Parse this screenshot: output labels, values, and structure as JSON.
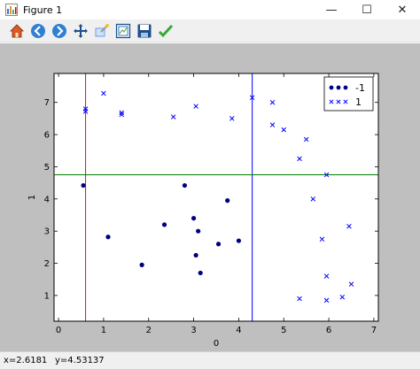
{
  "window": {
    "title": "Figure 1",
    "minimize_glyph": "—",
    "maximize_glyph": "☐",
    "close_glyph": "✕"
  },
  "toolbar": {
    "buttons": [
      "home-icon",
      "back-arrow-icon",
      "forward-arrow-icon",
      "pan-icon",
      "zoom-icon",
      "configure-subplots-icon",
      "save-icon",
      "edit-icon"
    ]
  },
  "status": {
    "x_readout": "x=2.6181",
    "y_readout": "y=4.53137"
  },
  "chart_data": {
    "type": "scatter",
    "xlabel": "0",
    "ylabel": "1",
    "xlim": [
      -0.1,
      7.1
    ],
    "ylim": [
      0.2,
      7.9
    ],
    "xticks": [
      "0",
      "1",
      "2",
      "3",
      "4",
      "5",
      "6",
      "7"
    ],
    "yticks": [
      "1",
      "2",
      "3",
      "4",
      "5",
      "6",
      "7"
    ],
    "vlines": [
      {
        "x": 0.6,
        "color": "#ff0000"
      },
      {
        "x": 4.3,
        "color": "#0000ff"
      }
    ],
    "hlines": [
      {
        "y": 4.75,
        "color": "#008000"
      }
    ],
    "legend_position": "top-right",
    "series": [
      {
        "name": "-1",
        "marker": "dot",
        "color": "#000080",
        "points": [
          [
            0.55,
            4.42
          ],
          [
            1.1,
            2.82
          ],
          [
            1.85,
            1.95
          ],
          [
            2.35,
            3.2
          ],
          [
            2.8,
            4.42
          ],
          [
            3.0,
            3.4
          ],
          [
            3.05,
            2.25
          ],
          [
            3.1,
            3.0
          ],
          [
            3.15,
            1.7
          ],
          [
            3.55,
            2.6
          ],
          [
            3.75,
            3.95
          ],
          [
            4.0,
            2.7
          ]
        ]
      },
      {
        "name": "1",
        "marker": "x",
        "color": "#0000ff",
        "points": [
          [
            0.6,
            6.8
          ],
          [
            0.6,
            6.72
          ],
          [
            1.0,
            7.28
          ],
          [
            1.4,
            6.68
          ],
          [
            1.4,
            6.62
          ],
          [
            2.55,
            6.55
          ],
          [
            3.05,
            6.88
          ],
          [
            3.85,
            6.5
          ],
          [
            4.3,
            7.15
          ],
          [
            4.75,
            7.0
          ],
          [
            4.75,
            6.3
          ],
          [
            5.0,
            6.15
          ],
          [
            5.35,
            5.25
          ],
          [
            5.5,
            5.85
          ],
          [
            5.65,
            4.0
          ],
          [
            5.95,
            4.75
          ],
          [
            5.85,
            2.75
          ],
          [
            6.45,
            3.15
          ],
          [
            5.35,
            0.9
          ],
          [
            5.95,
            1.6
          ],
          [
            5.95,
            0.85
          ],
          [
            6.3,
            0.95
          ],
          [
            6.5,
            1.35
          ]
        ]
      }
    ]
  }
}
